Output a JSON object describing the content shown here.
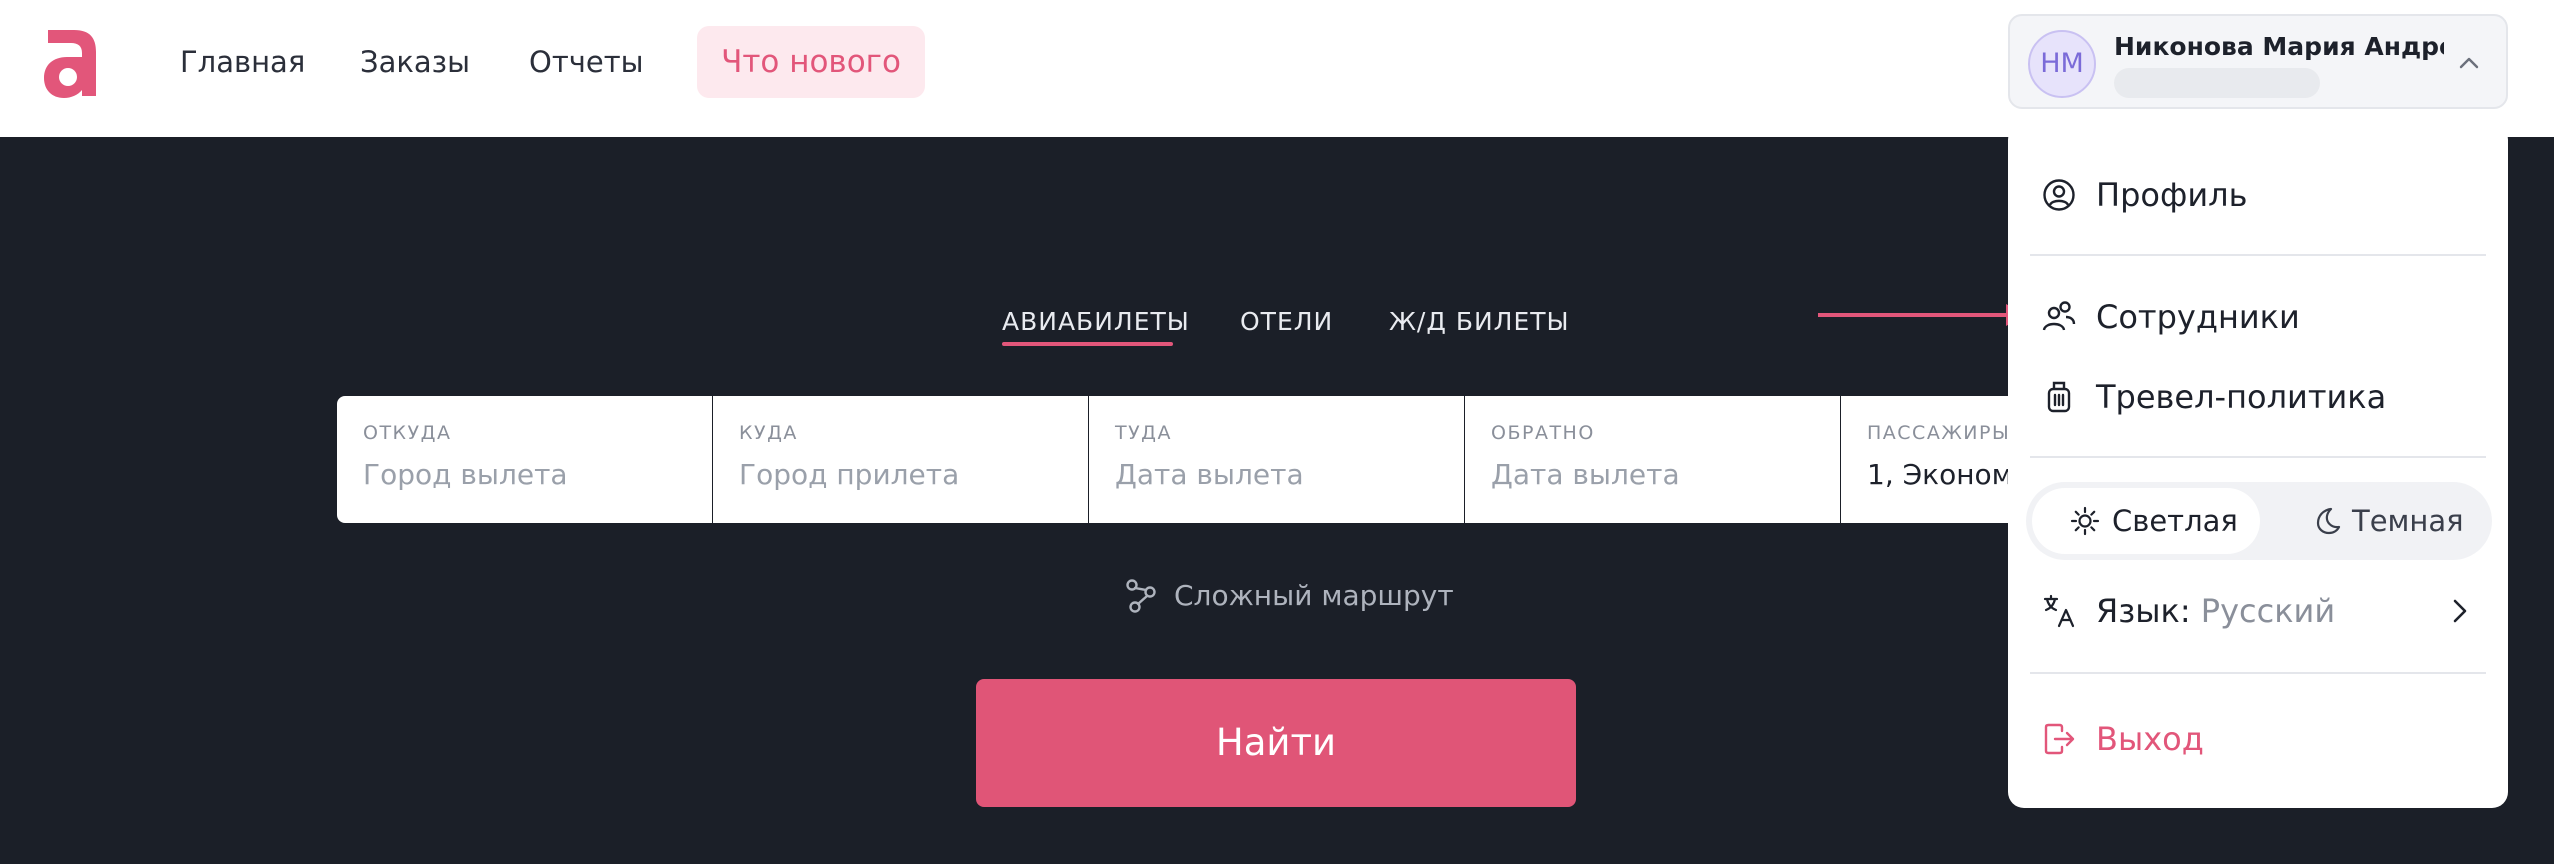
{
  "header": {
    "logo_letter": "a",
    "nav": {
      "home": "Главная",
      "orders": "Заказы",
      "reports": "Отчеты",
      "whats_new": "Что нового"
    },
    "user": {
      "initials": "НМ",
      "name": "Никонова Мария Андрее..."
    }
  },
  "search": {
    "tabs": [
      "АВИАБИЛЕТЫ",
      "ОТЕЛИ",
      "Ж/Д БИЛЕТЫ"
    ],
    "active_tab": "АВИАБИЛЕТЫ",
    "fields": [
      {
        "label": "ОТКУДА",
        "value": "Город вылета"
      },
      {
        "label": "КУДА",
        "value": "Город прилета"
      },
      {
        "label": "ТУДА",
        "value": "Дата вылета"
      },
      {
        "label": "ОБРАТНО",
        "value": "Дата вылета"
      },
      {
        "label": "ПАССАЖИРЫ",
        "value": "1, Эконом"
      }
    ],
    "complex_route": "Сложный маршрут",
    "find_button": "Найти"
  },
  "dropdown": {
    "profile": "Профиль",
    "employees": "Сотрудники",
    "travel_policy": "Тревел-политика",
    "theme_light": "Светлая",
    "theme_dark": "Темная",
    "theme_selected": "Светлая",
    "language_label": "Язык:",
    "language_value": "Русский",
    "logout": "Выход"
  },
  "colors": {
    "accent": "#e2567a",
    "background_dark": "#1b1f28",
    "find_button": "#e05577"
  },
  "icons": {
    "profile": "user-circle-icon",
    "employees": "users-icon",
    "travel_policy": "luggage-icon",
    "theme_light": "sun-icon",
    "theme_dark": "moon-icon",
    "language": "translate-icon",
    "logout": "logout-icon",
    "complex_route": "route-icon"
  }
}
